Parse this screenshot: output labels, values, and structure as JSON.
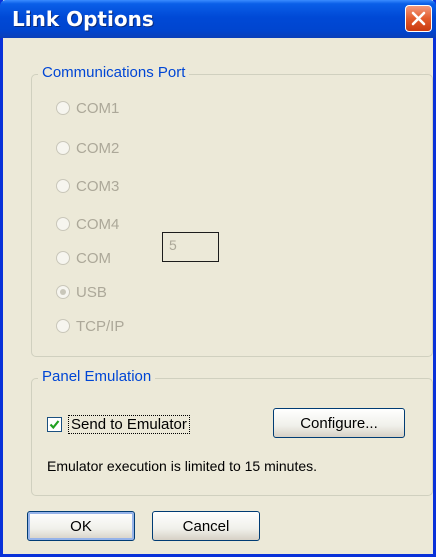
{
  "window": {
    "title": "Link Options"
  },
  "comm_group": {
    "label": "Communications Port",
    "options": [
      {
        "label": "COM1",
        "checked": false
      },
      {
        "label": "COM2",
        "checked": false
      },
      {
        "label": "COM3",
        "checked": false
      },
      {
        "label": "COM4",
        "checked": false
      },
      {
        "label": "COM",
        "checked": false
      },
      {
        "label": "USB",
        "checked": true
      },
      {
        "label": "TCP/IP",
        "checked": false
      }
    ],
    "com_number": "5"
  },
  "emulation_group": {
    "label": "Panel Emulation",
    "send_label": "Send to Emulator",
    "send_checked": true,
    "configure_label": "Configure...",
    "note": "Emulator execution is limited to 15 minutes."
  },
  "buttons": {
    "ok": "OK",
    "cancel": "Cancel"
  },
  "colors": {
    "title_blue": "#0049d6",
    "group_label": "#0046d5",
    "dialog_bg": "#ece9d8"
  }
}
